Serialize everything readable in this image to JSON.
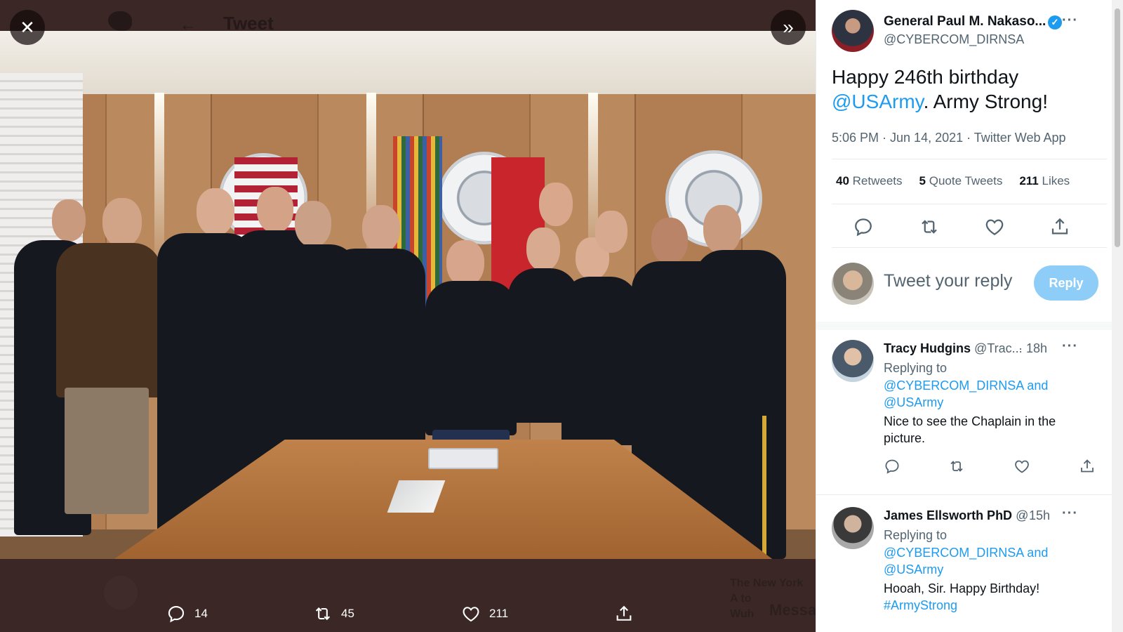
{
  "background": {
    "page_title": "Tweet",
    "news_source": "The New York",
    "news_line1": "A to",
    "news_line2": "Wuh",
    "messages_label": "Messa"
  },
  "viewer": {
    "close_icon": "close-icon",
    "expand_icon": "double-chevron-right-icon",
    "actions": {
      "replies": "14",
      "retweets": "45",
      "likes": "211"
    }
  },
  "tweet": {
    "author_name": "General Paul M. Nakaso...",
    "author_handle": "@CYBERCOM_DIRNSA",
    "verified": true,
    "text_before": "Happy 246th birthday ",
    "mention": "@USArmy",
    "text_after": ". Army Strong!",
    "meta": "5:06 PM · Jun 14, 2021 · Twitter Web App",
    "stats": {
      "retweets_count": "40",
      "retweets_label": "Retweets",
      "quotes_count": "5",
      "quotes_label": "Quote Tweets",
      "likes_count": "211",
      "likes_label": "Likes"
    },
    "reply_placeholder": "Tweet your reply",
    "reply_button": "Reply"
  },
  "replies": [
    {
      "name": "Tracy Hudgins",
      "handle": "@Trac...",
      "time": "· 18h",
      "replying_to": "Replying to",
      "mentions_line1": "@CYBERCOM_DIRNSA and",
      "mentions_line2": "@USArmy",
      "text_line1": "Nice to see the Chaplain in the",
      "text_line2": "picture."
    },
    {
      "name": "James Ellsworth PhD",
      "handle": "@",
      "time": "· 15h",
      "replying_to": "Replying to",
      "mentions_line1": "@CYBERCOM_DIRNSA and",
      "mentions_line2": "@USArmy",
      "text_line1": "Hooah, Sir. Happy Birthday!",
      "text_line2": "#ArmyStrong"
    }
  ],
  "colors": {
    "accent": "#1d9bf0",
    "reply_button_disabled": "#8ecdf8",
    "viewer_backdrop": "#3b2826"
  }
}
